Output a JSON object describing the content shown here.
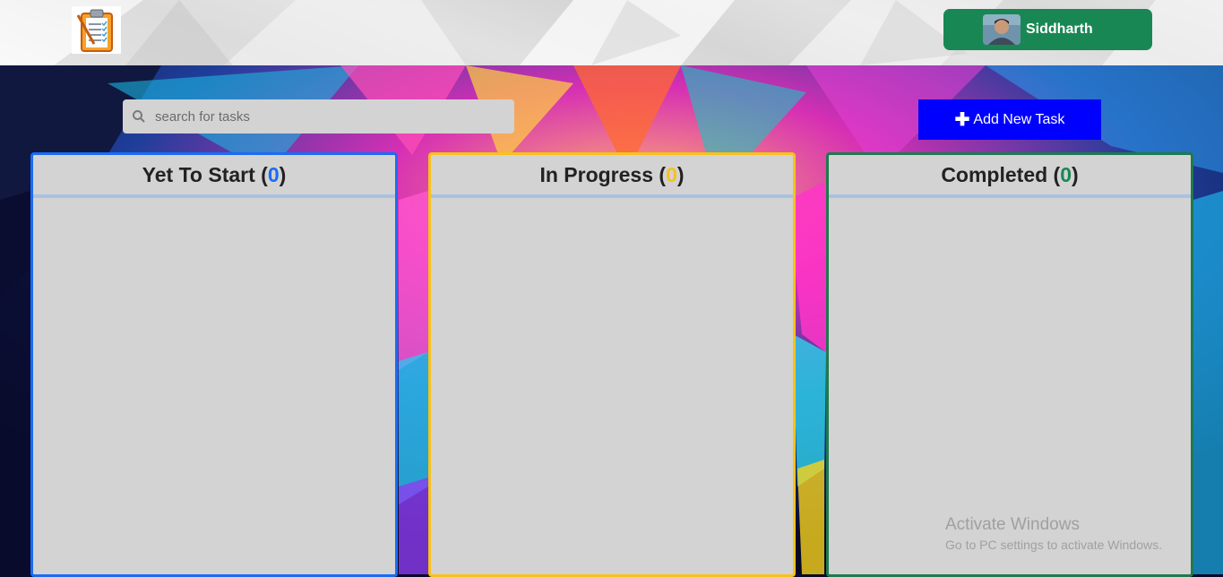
{
  "header": {
    "logo_icon": "clipboard-checklist-icon",
    "user": {
      "name": "Siddharth",
      "avatar": "user-avatar"
    }
  },
  "search": {
    "placeholder": "search for tasks",
    "value": ""
  },
  "toolbar": {
    "add_label": "Add New Task",
    "add_icon": "plus-icon"
  },
  "columns": [
    {
      "title": "Yet To Start",
      "count": "0",
      "accent": "#1a6cf5"
    },
    {
      "title": "In Progress",
      "count": "0",
      "accent": "#f6c21b"
    },
    {
      "title": "Completed",
      "count": "0",
      "accent": "#198754"
    }
  ],
  "watermark": {
    "title": "Activate Windows",
    "subtitle": "Go to PC settings to activate Windows."
  },
  "colors": {
    "user_button": "#198754",
    "add_button": "#0000ff",
    "panel_background": "#d3d3d3"
  }
}
